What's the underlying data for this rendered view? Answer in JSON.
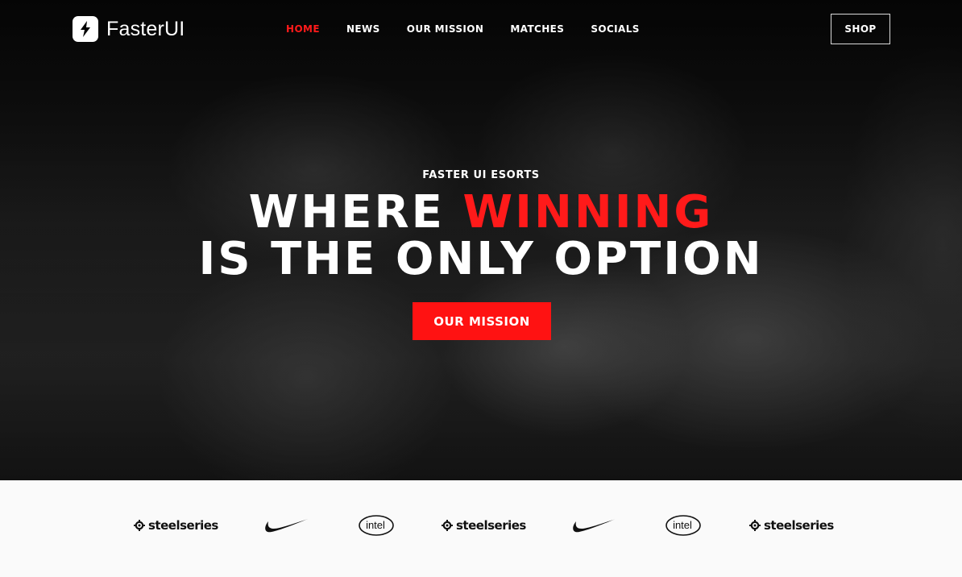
{
  "brand": {
    "name": "FasterUI",
    "logo_icon": "lightning-bolt-icon"
  },
  "nav": {
    "items": [
      {
        "label": "HOME",
        "active": true
      },
      {
        "label": "NEWS",
        "active": false
      },
      {
        "label": "OUR MISSION",
        "active": false
      },
      {
        "label": "MATCHES",
        "active": false
      },
      {
        "label": "SOCIALS",
        "active": false
      }
    ],
    "shop_label": "SHOP"
  },
  "hero": {
    "eyebrow": "FASTER UI ESORTS",
    "headline_line1_a": "WHERE ",
    "headline_line1_b": "WINNING",
    "headline_line2": "IS THE ONLY OPTION",
    "cta_label": "OUR MISSION"
  },
  "sponsors": {
    "items": [
      {
        "type": "steelseries",
        "label": "steelseries"
      },
      {
        "type": "nike-swoosh"
      },
      {
        "type": "intel",
        "label": "intel"
      },
      {
        "type": "steelseries",
        "label": "steelseries"
      },
      {
        "type": "nike-swoosh"
      },
      {
        "type": "intel",
        "label": "intel"
      },
      {
        "type": "steelseries",
        "label": "steelseries"
      }
    ]
  },
  "colors": {
    "accent": "#ff1a1a",
    "nav_text": "#ffffff",
    "sponsor_bg": "#fafafa"
  }
}
